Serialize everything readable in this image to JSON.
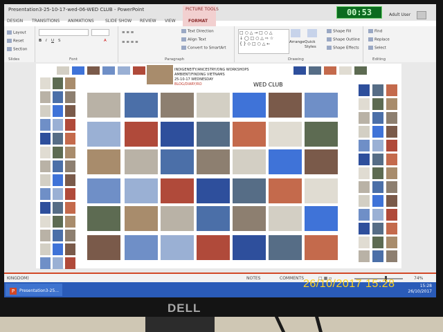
{
  "app": {
    "window_title": "Presentation3-25-10-17-wed-06-WED CLUB - PowerPoint",
    "context_tab_group": "PICTURE TOOLS",
    "user": "Adult User",
    "tabs": [
      "DESIGN",
      "TRANSITIONS",
      "ANIMATIONS",
      "SLIDE SHOW",
      "REVIEW",
      "VIEW",
      "FORMAT"
    ]
  },
  "ribbon": {
    "slides_group": {
      "name": "Slides",
      "layout": "Layout",
      "reset": "Reset",
      "section": "Section"
    },
    "font_group": {
      "name": "Font"
    },
    "paragraph_group": {
      "name": "Paragraph",
      "text_direction": "Text Direction",
      "align_text": "Align Text",
      "smartart": "Convert to SmartArt"
    },
    "drawing_group": {
      "name": "Drawing",
      "arrange": "Arrange",
      "quick_styles": "Quick Styles",
      "shape_fill": "Shape Fill",
      "shape_outline": "Shape Outline",
      "shape_effects": "Shape Effects"
    },
    "editing_group": {
      "name": "Editing",
      "find": "Find",
      "replace": "Replace",
      "select": "Select"
    }
  },
  "slide": {
    "heading": "WED CLUB",
    "header_lines": [
      "INDIGENEITY/ANCESTRY/ONG WORKSHOPS",
      "AMBIENT/FINDING VIETNAMS",
      "25-10-17 WEDNESDAY",
      "BLOG/DIARY/RO"
    ]
  },
  "status": {
    "region": "KINGDOM)",
    "notes": "NOTES",
    "comments": "COMMENTS",
    "zoom": "74%"
  },
  "taskbar": {
    "item_label": "Presentation3-25...",
    "clock_time": "15:28",
    "clock_date": "26/10/2017"
  },
  "overlay": {
    "timer": "00:53",
    "date_stamp": "26/10/2017 15:28",
    "monitor_brand": "DELL"
  },
  "colors": {
    "accent": "#d24726",
    "taskbar": "#2a5bb8",
    "timer_bg": "#0b6b1f",
    "stamp": "#ffd21e"
  }
}
